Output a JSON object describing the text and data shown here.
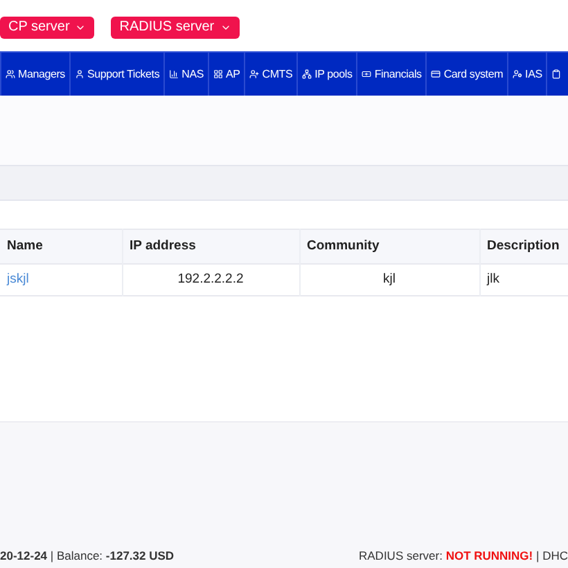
{
  "server_buttons": [
    "CP server",
    "RADIUS server"
  ],
  "nav": [
    {
      "label": "Managers"
    },
    {
      "label": "Support Tickets"
    },
    {
      "label": "NAS"
    },
    {
      "label": "AP"
    },
    {
      "label": "CMTS"
    },
    {
      "label": "IP pools"
    },
    {
      "label": "Financials"
    },
    {
      "label": "Card system"
    },
    {
      "label": "IAS"
    }
  ],
  "table": {
    "columns": [
      "Name",
      "IP address",
      "Community",
      "Description"
    ],
    "rows": [
      [
        "jskjl",
        "192.2.2.2.2",
        "kjl",
        "jlk"
      ]
    ]
  },
  "footer": {
    "left": "**20-12-24** | Balance: **-127.32 USD**",
    "right": "RADIUS server: **NOT RUNNING!** | DHC"
  }
}
